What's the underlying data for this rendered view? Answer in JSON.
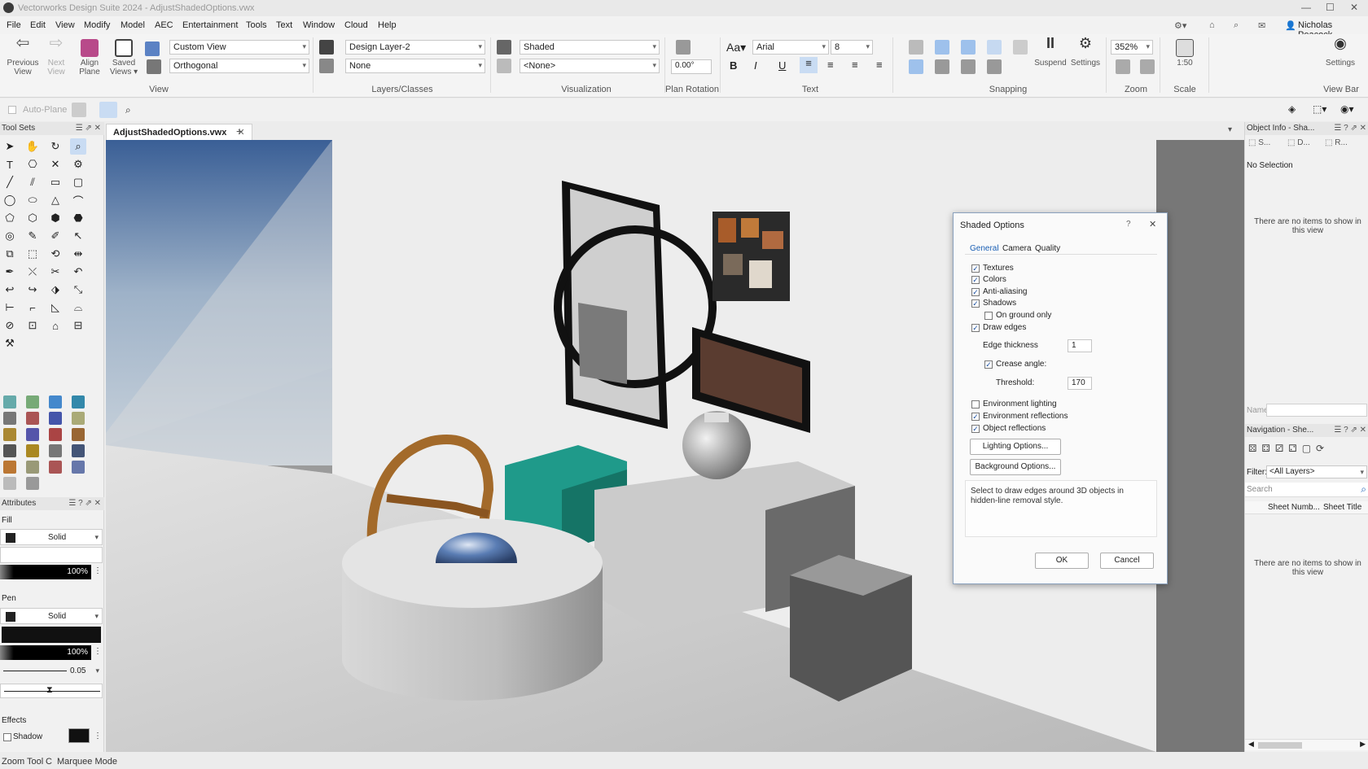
{
  "titlebar": {
    "title": "Vectorworks Design Suite 2024 - AdjustShadedOptions.vwx"
  },
  "menu": [
    "File",
    "Edit",
    "View",
    "Modify",
    "Model",
    "AEC",
    "Entertainment",
    "Tools",
    "Text",
    "Window",
    "Cloud",
    "Help"
  ],
  "user": {
    "name": "Nicholas Peacock"
  },
  "ribbon": {
    "view_buttons": [
      {
        "label": "Previous\nView"
      },
      {
        "label": "Next\nView"
      },
      {
        "label": "Align\nPlane"
      },
      {
        "label": "Saved\nViews"
      }
    ],
    "view_dd": "Custom View",
    "projection_dd": "Orthogonal",
    "view_group": "View",
    "layer_dd": "Design Layer-2",
    "class_dd": "None",
    "layers_group": "Layers/Classes",
    "render_dd": "Shaded",
    "render2_dd": "<None>",
    "vis_group": "Visualization",
    "plan_rotation": "0.00°",
    "plan_group": "Plan Rotation",
    "font_dd": "Arial",
    "size_dd": "8",
    "text_group": "Text",
    "snapping_group": "Snapping",
    "suspend": "Suspend",
    "settings": "Settings",
    "zoom": "352%",
    "zoom_group": "Zoom",
    "scale": "1:50",
    "scale_group": "Scale",
    "viewbar_settings": "Settings",
    "viewbar_group": "View Bar"
  },
  "toolbar2": {
    "auto_plane": "Auto-Plane"
  },
  "tab": {
    "file": "AdjustShadedOptions.vwx"
  },
  "left": {
    "toolsets": "Tool Sets",
    "attributes": "Attributes",
    "fill": "Fill",
    "fill_style": "Solid",
    "fill_opacity": "100%",
    "pen": "Pen",
    "pen_style": "Solid",
    "pen_opacity": "100%",
    "line_weight": "0.05",
    "effects": "Effects",
    "shadow": "Shadow"
  },
  "right": {
    "oip_title": "Object Info - Sha...",
    "oip_tabs": [
      "S...",
      "D...",
      "R..."
    ],
    "no_selection": "No Selection",
    "empty": "There are no items to show in this view",
    "name_label": "Name",
    "nav_title": "Navigation - She...",
    "filter_label": "Filter:",
    "filter_value": "<All Layers>",
    "search": "Search",
    "col1": "Sheet Numb...",
    "col2": "Sheet Title",
    "empty2": "There are no items to show in this view"
  },
  "dialog": {
    "title": "Shaded Options",
    "tabs": [
      "General",
      "Camera",
      "Quality"
    ],
    "options": [
      {
        "label": "Textures",
        "checked": true
      },
      {
        "label": "Colors",
        "checked": true
      },
      {
        "label": "Anti-aliasing",
        "checked": true
      },
      {
        "label": "Shadows",
        "checked": true
      },
      {
        "label": "On ground only",
        "checked": false
      },
      {
        "label": "Draw edges",
        "checked": true
      }
    ],
    "edge_thickness_label": "Edge thickness",
    "edge_thickness": "1",
    "crease_label": "Crease angle:",
    "crease_checked": true,
    "threshold_label": "Threshold:",
    "threshold": "170",
    "options2": [
      {
        "label": "Environment lighting",
        "checked": false
      },
      {
        "label": "Environment reflections",
        "checked": true
      },
      {
        "label": "Object reflections",
        "checked": true
      }
    ],
    "lighting_btn": "Lighting Options...",
    "background_btn": "Background Options...",
    "help_text": "Select to draw edges around 3D objects in hidden-line removal style.",
    "ok": "OK",
    "cancel": "Cancel"
  },
  "status": {
    "tool": "Zoom Tool",
    "key": "C",
    "mode": "Marquee Mode"
  }
}
